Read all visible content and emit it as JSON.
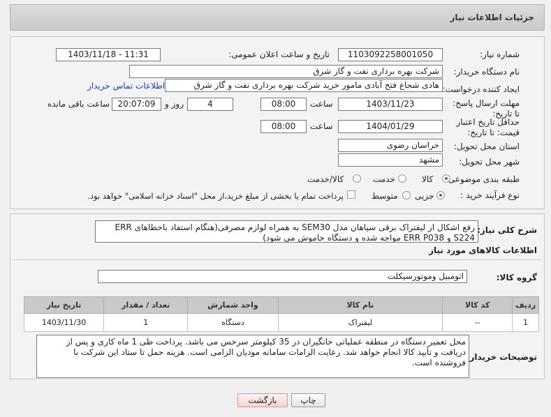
{
  "header": {
    "title": "جزئیات اطلاعات نیاز"
  },
  "form": {
    "need_number_label": "شماره نیاز:",
    "need_number": "1103092258001050",
    "announce_label": "تاریخ و ساعت اعلان عمومی:",
    "announce_value": "1403/11/18 - 11:31",
    "buyer_org_label": "نام دستگاه خریدار:",
    "buyer_org": "شرکت بهره برداری نفت و گاز شرق",
    "creator_label": "ایجاد کننده درخواست:",
    "creator": "هادی شجاع فتح آبادی مامور خرید شرکت بهره برداری نفت و گاز شرق",
    "contact_link": "اطلاعات تماس خریدار",
    "reply_deadline_label": "مهلت ارسال پاسخ: تا تاریخ:",
    "reply_date": "1403/11/23",
    "time_label": "ساعت",
    "reply_time": "08:00",
    "days_value": "4",
    "days_label": "روز و",
    "remaining_time": "20:07:09",
    "remaining_label": "ساعت باقی مانده",
    "validity_label": "حداقل تاریخ اعتبار قیمت: تا تاریخ:",
    "validity_date": "1404/01/29",
    "validity_time": "08:00",
    "province_label": "استان محل تحویل:",
    "province": "خراسان رضوی",
    "city_label": "شهر محل تحویل:",
    "city": "مشهد",
    "category_label": "طبقه بندی موضوعی:",
    "category_options": [
      "کالا",
      "خدمت",
      "کالا/خدمت"
    ],
    "purchase_type_label": "نوع فرآیند خرید :",
    "purchase_options": [
      "جزیی",
      "متوسط"
    ],
    "payment_note": "پرداخت تمام یا بخشی از مبلغ خرید،از محل \"اسناد خزانه اسلامی\" خواهد بود."
  },
  "summary": {
    "label": "شرح کلی نیاز:",
    "text": "رفع اشکال از لیفتراک برقی سپاهان مدل SEM30 به همراه لوازم مصرفی(هنگام استفاد باخطاهای ERR S224 و ERR P038 مواجه شده و دستگاه خاموش می شود)"
  },
  "goods": {
    "section_title": "اطلاعات کالاهای مورد نیاز",
    "group_label": "گروه کالا:",
    "group_value": "اتومبیل وموتورسیکلت",
    "columns": [
      "ردیف",
      "کد کالا",
      "نام کالا",
      "واحد شمارش",
      "تعداد / مقدار",
      "تاریخ نیاز"
    ],
    "rows": [
      [
        "1",
        "--",
        "لیفتراک",
        "دستگاه",
        "1",
        "1403/11/30"
      ]
    ]
  },
  "buyer_notes": {
    "label": "توضیحات خریدار:",
    "text": "محل تعمیر دستگاه در منطقه عملیاتی خانگیران در 35 کیلومتر سرخس می باشد. پرداخت طی  1 ماه کاری و پس از دریافت و تأیید کالا انجام خواهد شد. رعایت الزامات سامانه مودیان الزامی است. هزینه حمل تا ستاد این شرکت با فروشنده است."
  },
  "buttons": {
    "print": "چاپ",
    "back": "بازگشت"
  }
}
